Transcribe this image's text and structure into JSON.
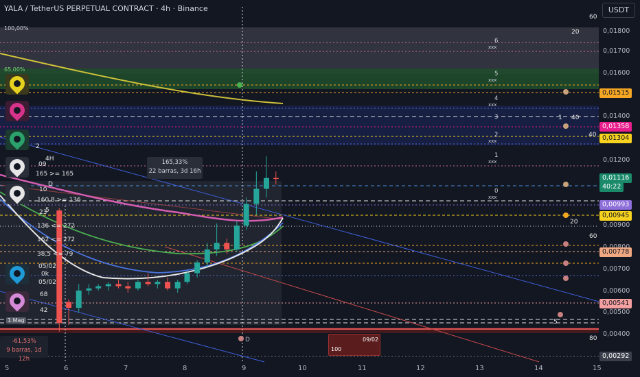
{
  "header": {
    "title": "YALA / TetherUS PERPETUAL CONTRACT · 4h · Binance",
    "currency_button": "USDT"
  },
  "zones": {
    "pct_100": "100,00%",
    "pct_65": "65,00%"
  },
  "y_axis": {
    "ticks": [
      "0,01800",
      "0,01700",
      "0,01600",
      "0,01400",
      "0,01200",
      "0,00900",
      "0,00800",
      "0,00700",
      "0,00600",
      "0,00500",
      "0,00400"
    ],
    "tags": [
      {
        "text": "0,01515",
        "bg": "#f5a623",
        "fg": "#131722"
      },
      {
        "text": "0,01358",
        "bg": "#e91e8c",
        "fg": "#ffffff"
      },
      {
        "text": "0,01304",
        "bg": "#f7d21e",
        "fg": "#131722"
      },
      {
        "text": "0,01116",
        "bg": "#1b8a6b",
        "fg": "#ffffff"
      },
      {
        "text": "40:22",
        "bg": "#1b8a6b",
        "fg": "#ffffff"
      },
      {
        "text": "0,00993",
        "bg": "#8e6fd9",
        "fg": "#ffffff"
      },
      {
        "text": "0,00945",
        "bg": "#f7d21e",
        "fg": "#131722"
      },
      {
        "text": "0,00778",
        "bg": "#f0a882",
        "fg": "#131722"
      },
      {
        "text": "0,00541",
        "bg": "#f4a0a0",
        "fg": "#131722"
      },
      {
        "text": "0,00292",
        "bg": "#3a3f4b",
        "fg": "#ffffff"
      }
    ]
  },
  "x_axis": {
    "labels": [
      "5",
      "6",
      "7",
      "8",
      "9",
      "10",
      "11",
      "12",
      "13",
      "14",
      "15"
    ]
  },
  "fib_levels": [
    {
      "num": "6",
      "x": "xxx"
    },
    {
      "num": "5",
      "x": "xxx"
    },
    {
      "num": "4",
      "x": "xxx"
    },
    {
      "num": "3",
      "x": ""
    },
    {
      "num": "2",
      "x": "xxx"
    },
    {
      "num": "1",
      "x": "xxx"
    },
    {
      "num": "0",
      "x": "xxx"
    }
  ],
  "measure_up": {
    "line1": "165,33%",
    "line2": "22 barras, 3d 16h"
  },
  "measure_down": {
    "line1": "-61,53%",
    "line2": "9 barras, 1d 12h"
  },
  "left_labels": {
    "l_2": "2",
    "l_4h": "4H",
    "l_09": "09",
    "l_165": "165 >= 165",
    "l_d": "D",
    "l_10": "10",
    "l_1608": "160,8 >= 136",
    "l_23": "23",
    "l_5": "5",
    "l_136": "136 <= 272",
    "l_162": "162 <= 272",
    "l_385": "38,5 <= 79",
    "l_0502a": "05/02",
    "l_0k": "0k",
    "l_0502b": "05/02",
    "l_68": "68",
    "l_42": "42",
    "mag": "1 Mag"
  },
  "right_labels": {
    "r60a": "60",
    "r20a": "20",
    "r1": "1",
    "r40a": "40",
    "r40b": "40",
    "r20b": "20",
    "r60b": "60",
    "r80": "80",
    "r5": "5"
  },
  "chip": {
    "date": "09/02",
    "num": "100"
  },
  "day_marker": "D",
  "chart_data": {
    "type": "candlestick",
    "title": "YALA / TetherUS PERPETUAL CONTRACT · 4h · Binance",
    "ylim": [
      0.0028,
      0.0192
    ],
    "x_range_days": [
      4.8,
      15.0
    ],
    "candles": [
      {
        "t": 5.92,
        "o": 0.0097,
        "h": 0.0098,
        "l": 0.0041,
        "c": 0.0045
      },
      {
        "t": 6.08,
        "o": 0.00547,
        "h": 0.0056,
        "l": 0.0044,
        "c": 0.0052
      },
      {
        "t": 6.25,
        "o": 0.0052,
        "h": 0.0063,
        "l": 0.005,
        "c": 0.006
      },
      {
        "t": 6.42,
        "o": 0.006,
        "h": 0.0063,
        "l": 0.0058,
        "c": 0.0061
      },
      {
        "t": 6.58,
        "o": 0.0061,
        "h": 0.0063,
        "l": 0.006,
        "c": 0.0062
      },
      {
        "t": 6.75,
        "o": 0.0062,
        "h": 0.0064,
        "l": 0.006,
        "c": 0.0063
      },
      {
        "t": 6.92,
        "o": 0.0063,
        "h": 0.0065,
        "l": 0.0061,
        "c": 0.0062
      },
      {
        "t": 7.08,
        "o": 0.0062,
        "h": 0.0064,
        "l": 0.0059,
        "c": 0.0061
      },
      {
        "t": 7.25,
        "o": 0.0061,
        "h": 0.0065,
        "l": 0.006,
        "c": 0.0064
      },
      {
        "t": 7.42,
        "o": 0.0064,
        "h": 0.0068,
        "l": 0.0062,
        "c": 0.0063
      },
      {
        "t": 7.58,
        "o": 0.0063,
        "h": 0.0065,
        "l": 0.0061,
        "c": 0.0064
      },
      {
        "t": 7.75,
        "o": 0.0064,
        "h": 0.0066,
        "l": 0.006,
        "c": 0.0061
      },
      {
        "t": 7.92,
        "o": 0.0061,
        "h": 0.0065,
        "l": 0.0059,
        "c": 0.0064
      },
      {
        "t": 8.08,
        "o": 0.0064,
        "h": 0.0069,
        "l": 0.0063,
        "c": 0.0068
      },
      {
        "t": 8.25,
        "o": 0.0068,
        "h": 0.0074,
        "l": 0.0066,
        "c": 0.0073
      },
      {
        "t": 8.42,
        "o": 0.0073,
        "h": 0.0082,
        "l": 0.0071,
        "c": 0.0079
      },
      {
        "t": 8.58,
        "o": 0.0079,
        "h": 0.0091,
        "l": 0.0076,
        "c": 0.0082
      },
      {
        "t": 8.75,
        "o": 0.0082,
        "h": 0.0084,
        "l": 0.0077,
        "c": 0.0079
      },
      {
        "t": 8.92,
        "o": 0.0079,
        "h": 0.0092,
        "l": 0.0078,
        "c": 0.009
      },
      {
        "t": 9.08,
        "o": 0.009,
        "h": 0.0103,
        "l": 0.0088,
        "c": 0.01
      },
      {
        "t": 9.25,
        "o": 0.01,
        "h": 0.0115,
        "l": 0.0095,
        "c": 0.0107
      },
      {
        "t": 9.42,
        "o": 0.0107,
        "h": 0.0122,
        "l": 0.0103,
        "c": 0.0112
      },
      {
        "t": 9.58,
        "o": 0.0112,
        "h": 0.0115,
        "l": 0.0109,
        "c": 0.01116
      }
    ]
  }
}
